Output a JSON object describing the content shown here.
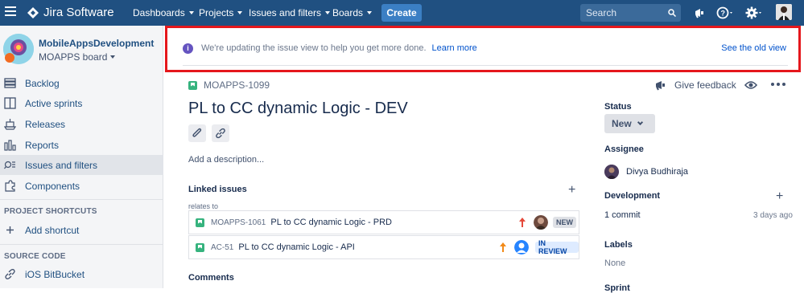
{
  "topbar": {
    "logo_text": "Jira Software",
    "nav": [
      "Dashboards",
      "Projects",
      "Issues and filters",
      "Boards"
    ],
    "create_label": "Create",
    "search_placeholder": "Search",
    "colors": {
      "bar": "#205081",
      "create": "#3B7FC4"
    }
  },
  "sidebar": {
    "project_name": "MobileAppsDevelopment",
    "board_name": "MOAPPS board",
    "items": [
      {
        "label": "Backlog",
        "icon": "backlog-icon"
      },
      {
        "label": "Active sprints",
        "icon": "board-icon"
      },
      {
        "label": "Releases",
        "icon": "ship-icon"
      },
      {
        "label": "Reports",
        "icon": "chart-icon"
      },
      {
        "label": "Issues and filters",
        "icon": "filter-icon",
        "active": true
      },
      {
        "label": "Components",
        "icon": "puzzle-icon"
      }
    ],
    "shortcuts_heading": "PROJECT SHORTCUTS",
    "add_shortcut": "Add shortcut",
    "source_heading": "SOURCE CODE",
    "source_item": "iOS BitBucket"
  },
  "banner": {
    "message": "We're updating the issue view to help you get more done.",
    "learn_more": "Learn more",
    "old_view": "See the old view",
    "highlight_color": "#E5171C"
  },
  "issue": {
    "key": "MOAPPS-1099",
    "feedback": "Give feedback",
    "title": "PL to CC dynamic Logic - DEV",
    "description_placeholder": "Add a description...",
    "linked_title": "Linked issues",
    "relates_to": "relates to",
    "links": [
      {
        "key": "MOAPPS-1061",
        "summary": "PL to CC dynamic Logic - PRD",
        "status": "NEW",
        "priority_color": "#E5493A"
      },
      {
        "key": "AC-51",
        "summary": "PL to CC dynamic Logic - API",
        "status": "IN REVIEW",
        "priority_color": "#F28A18"
      }
    ],
    "comments_title": "Comments"
  },
  "details": {
    "status_label": "Status",
    "status_value": "New",
    "assignee_label": "Assignee",
    "assignee_name": "Divya Budhiraja",
    "development_label": "Development",
    "commit_text": "1 commit",
    "commit_ago": "3 days ago",
    "labels_label": "Labels",
    "labels_value": "None",
    "sprint_label": "Sprint"
  }
}
